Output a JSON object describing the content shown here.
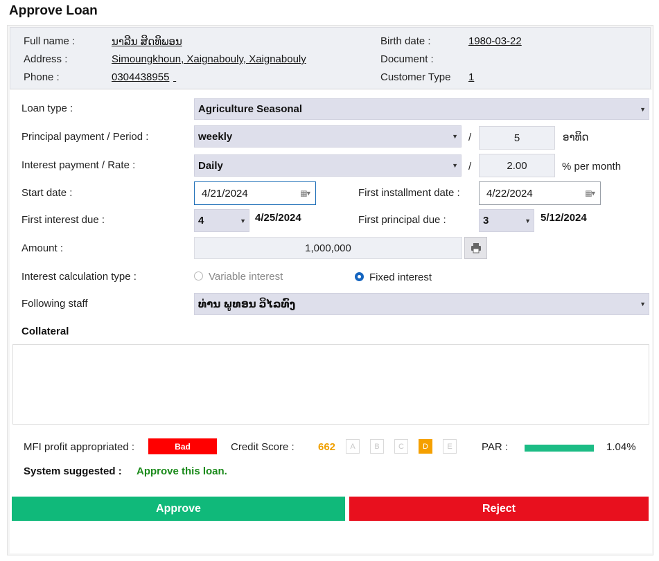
{
  "page": {
    "title": "Approve Loan"
  },
  "customer": {
    "full_name_label": "Full name :",
    "full_name": "ນາລີນ ສິດທິພອນ",
    "address_label": "Address :",
    "address": "Simoungkhoun, Xaignabouly, Xaignabouly",
    "phone_label": "Phone :",
    "phone": "0304438955",
    "birth_label": "Birth date :",
    "birth": "1980-03-22",
    "document_label": "Document :",
    "document": "",
    "type_label": "Customer Type",
    "type": "1"
  },
  "form": {
    "loan_type": {
      "label": "Loan type :",
      "value": "Agriculture Seasonal"
    },
    "principal": {
      "label": "Principal payment / Period :",
      "value": "weekly",
      "slash": "/",
      "period": "5",
      "unit": "ອາທິດ"
    },
    "interest": {
      "label": "Interest payment / Rate :",
      "value": "Daily",
      "slash": "/",
      "rate": "2.00",
      "unit": "% per month"
    },
    "start_date": {
      "label": "Start date :",
      "value": "4/21/2024"
    },
    "first_installment": {
      "label": "First installment date :",
      "value": "4/22/2024"
    },
    "first_interest_due": {
      "label": "First interest due :",
      "value": "4",
      "date": "4/25/2024"
    },
    "first_principal_due": {
      "label": "First principal due :",
      "value": "3",
      "date": "5/12/2024"
    },
    "amount": {
      "label": "Amount :",
      "value": "1,000,000"
    },
    "calc_type": {
      "label": "Interest calculation type :",
      "option1": "Variable interest",
      "option2": "Fixed interest",
      "selected": "Fixed interest"
    },
    "staff": {
      "label": "Following staff",
      "value": "ທ່ານ ພູທອນ ວິໄລທົງ"
    },
    "collateral": {
      "label": "Collateral",
      "value": ""
    }
  },
  "score": {
    "mfi_label": "MFI profit appropriated :",
    "mfi_value": "Bad",
    "credit_label": "Credit Score :",
    "credit_value": "662",
    "grades": [
      "A",
      "B",
      "C",
      "D",
      "E"
    ],
    "active_grade": "D",
    "par_label": "PAR :",
    "par_value": "1.04%",
    "suggest_label": "System suggested :",
    "suggest_value": "Approve this loan."
  },
  "actions": {
    "approve": "Approve",
    "reject": "Reject"
  },
  "colors": {
    "approve": "#10b97a",
    "reject": "#e8101e",
    "bad": "#ff0000",
    "grade_active": "#f5a000",
    "par": "#1cbc85"
  },
  "icons": {
    "dropdown": "chevron-down-icon",
    "calendar": "calendar-icon",
    "print": "print-icon"
  }
}
